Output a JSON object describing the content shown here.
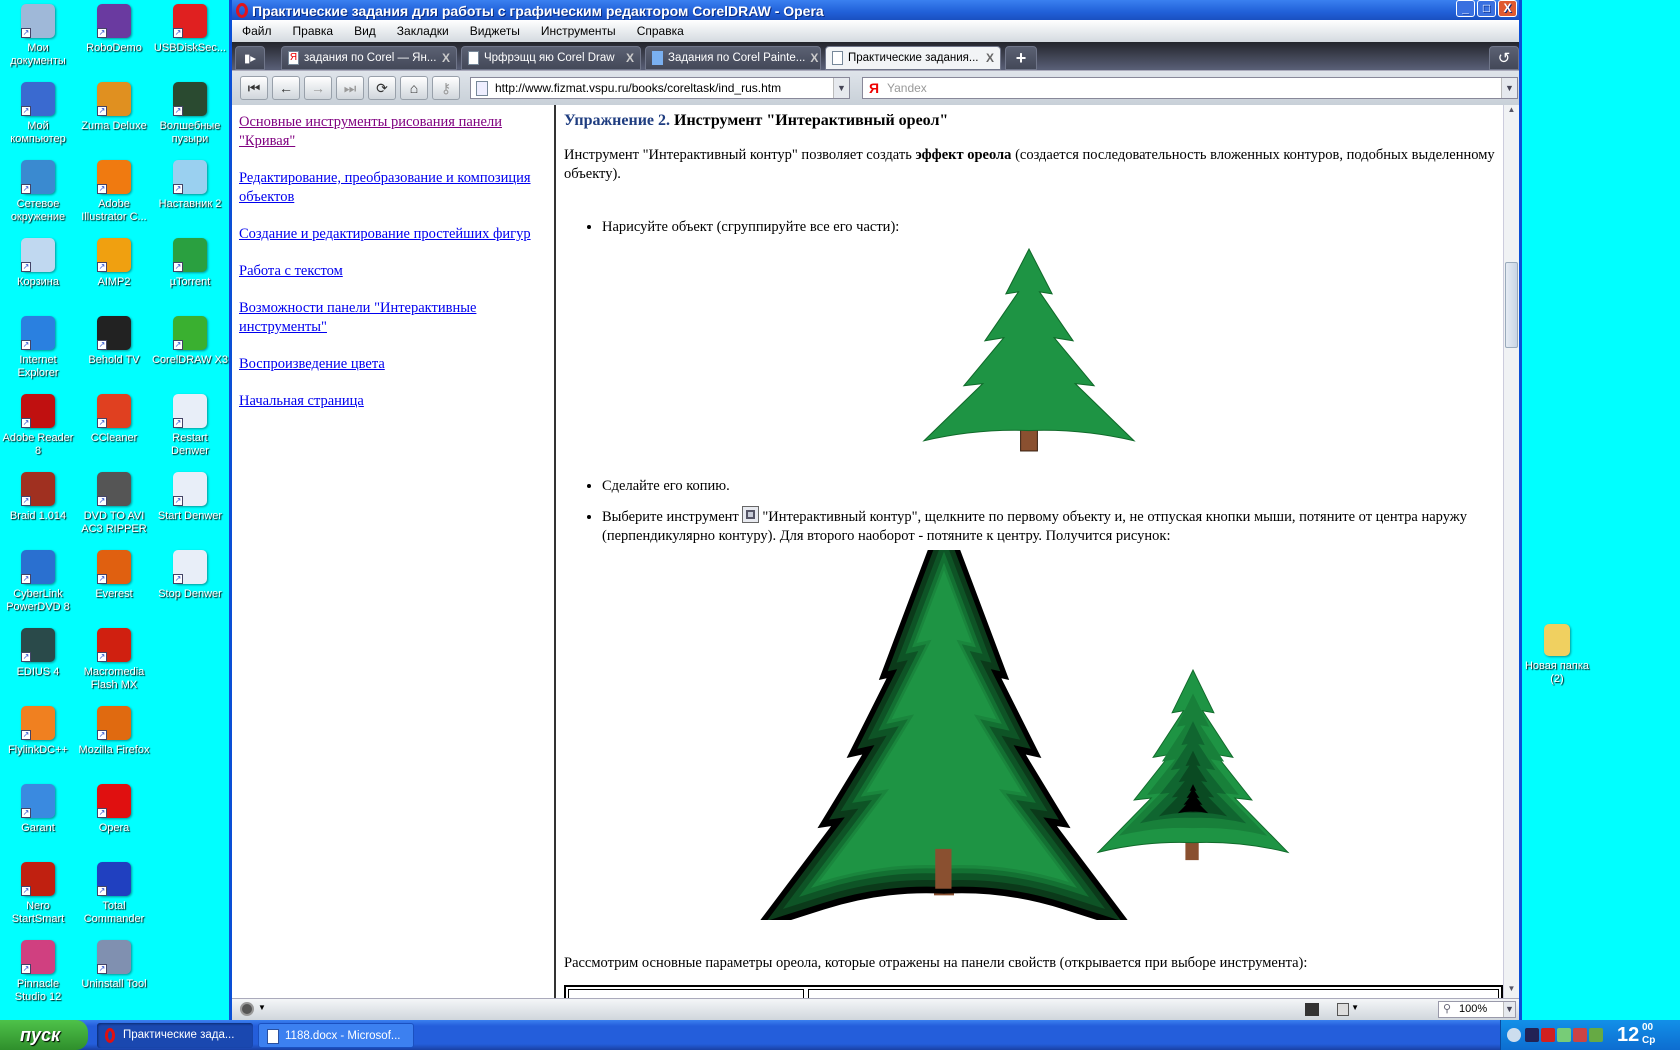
{
  "desktop": {
    "icons": [
      {
        "label": "Мои документы",
        "color": "#9fb8d8"
      },
      {
        "label": "RoboDemo",
        "color": "#6a3aa0"
      },
      {
        "label": "USBDiskSec...",
        "color": "#e02020"
      },
      {
        "label": "Мой компьютер",
        "color": "#3a6ad0"
      },
      {
        "label": "Zuma Deluxe",
        "color": "#e09020"
      },
      {
        "label": "Волшебные пузыри",
        "color": "#2a4a30"
      },
      {
        "label": "Сетевое окружение",
        "color": "#3a8ad0"
      },
      {
        "label": "Adobe Illustrator C...",
        "color": "#f07a10"
      },
      {
        "label": "Наставник 2",
        "color": "#9ad0f0"
      },
      {
        "label": "Корзина",
        "color": "#c0d8f0"
      },
      {
        "label": "AIMP2",
        "color": "#f0a010"
      },
      {
        "label": "µTorrent",
        "color": "#2aa040"
      },
      {
        "label": "Internet Explorer",
        "color": "#2a80e0"
      },
      {
        "label": "Behold TV",
        "color": "#222"
      },
      {
        "label": "CorelDRAW X3",
        "color": "#3ab030"
      },
      {
        "label": "Adobe Reader 8",
        "color": "#c01010"
      },
      {
        "label": "CCleaner",
        "color": "#e04020"
      },
      {
        "label": "Restart Denwer",
        "color": "#e8eef8"
      },
      {
        "label": "Braid 1.014",
        "color": "#a03020"
      },
      {
        "label": "DVD TO AVI AC3 RIPPER",
        "color": "#555"
      },
      {
        "label": "Start Denwer",
        "color": "#e8eef8"
      },
      {
        "label": "CyberLink PowerDVD 8",
        "color": "#2a70d0"
      },
      {
        "label": "Everest",
        "color": "#e06010"
      },
      {
        "label": "Stop Denwer",
        "color": "#e8eef8"
      },
      {
        "label": "EDIUS 4",
        "color": "#2a4a4a"
      },
      {
        "label": "Macromedia Flash MX",
        "color": "#d02010"
      },
      {
        "label": "FlylinkDC++",
        "color": "#f08020"
      },
      {
        "label": "Mozilla Firefox",
        "color": "#e06a10"
      },
      {
        "label": "Garant",
        "color": "#3a8ae0"
      },
      {
        "label": "Opera",
        "color": "#e01010"
      },
      {
        "label": "Nero StartSmart",
        "color": "#c02010"
      },
      {
        "label": "Total Commander",
        "color": "#2040c0"
      },
      {
        "label": "Pinnacle Studio 12",
        "color": "#d04080"
      },
      {
        "label": "Uninstall Tool",
        "color": "#8090b0"
      }
    ],
    "right_icon": {
      "label": "Новая папка (2)",
      "color": "#f0d060"
    }
  },
  "window": {
    "title": "Практические задания для работы с графическим редактором CorelDRAW - Opera",
    "controls": {
      "minimize": "_",
      "maximize": "□",
      "close": "X"
    }
  },
  "menu": [
    "Файл",
    "Правка",
    "Вид",
    "Закладки",
    "Виджеты",
    "Инструменты",
    "Справка"
  ],
  "tabs": [
    {
      "label": "задания по Corel — Ян...",
      "close": "X"
    },
    {
      "label": "Чрфрэщц яю Corel Draw",
      "close": "X"
    },
    {
      "label": "Задания по Corel Painte...",
      "close": "X"
    },
    {
      "label": "Практические задания...",
      "close": "X",
      "active": true
    }
  ],
  "toolbar": {
    "url": "http://www.fizmat.vspu.ru/books/coreltask/ind_rus.htm",
    "search_placeholder": "Yandex",
    "search_logo": "Я"
  },
  "nav_links": [
    {
      "label": "Основные инструменты рисования панели \"Кривая\"",
      "visited": true
    },
    {
      "label": "Редактирование, преобразование и композиция объектов"
    },
    {
      "label": "Создание и редактирование простейших фигур"
    },
    {
      "label": "Работа с текстом"
    },
    {
      "label": "Возможности панели \"Интерактивные инструменты\""
    },
    {
      "label": "Воспроизведение цвета"
    },
    {
      "label": "Начальная страница"
    }
  ],
  "content": {
    "heading_number": "Упражнение 2.",
    "heading_title": "Инструмент \"Интерактивный ореол\"",
    "intro_a": "Инструмент \"Интерактивный контур\" позволяет создать ",
    "intro_bold": "эффект ореола",
    "intro_b": " (создается последовательность вложенных контуров, подобных выделенному объекту).",
    "step1": "Нарисуйте объект (сгруппируйте все его части):",
    "step2": "Сделайте его копию.",
    "step3_a": "Выберите инструмент ",
    "step3_b": "\"Интерактивный контур\", щелкните по первому объекту и, не отпуская кнопки мыши, потяните от центра наружу (перпендикулярно контуру). Для второго наоборот - потяните к центру. Получится рисунок:",
    "para": "Рассмотрим основные параметры ореола, которые отражены на панели свойств (открывается при выборе инструмента):"
  },
  "status": {
    "zoom": "100%"
  },
  "taskbar": {
    "start": "пуск",
    "tasks": [
      "Практические зада...",
      "1188.docx - Microsof..."
    ],
    "clock": "12",
    "clock_min": "00",
    "day": "Ср"
  }
}
